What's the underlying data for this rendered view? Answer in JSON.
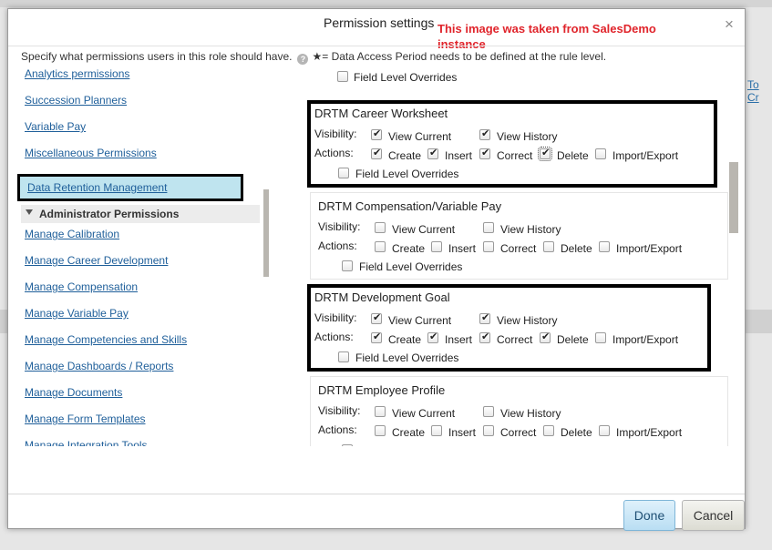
{
  "dialog": {
    "title": "Permission settings",
    "note": "This image was taken from SalesDemo instance",
    "description": "Specify what permissions users in this role should have.",
    "help_glyph": "?",
    "data_access_note": "★= Data Access Period needs to be defined at the rule level.",
    "close": "×",
    "done": "Done",
    "cancel": "Cancel"
  },
  "background": {
    "link_fragment": "To Cr"
  },
  "nav": {
    "items_top": [
      "Analytics permissions",
      "Succession Planners",
      "Variable Pay",
      "Miscellaneous Permissions"
    ],
    "selected": "Data Retention Management",
    "section": "Administrator Permissions",
    "items_bottom": [
      "Manage Calibration",
      "Manage Career Development",
      "Manage Compensation",
      "Manage Variable Pay",
      "Manage Competencies and Skills",
      "Manage Dashboards / Reports",
      "Manage Documents",
      "Manage Form Templates",
      "Manage Integration Tools"
    ]
  },
  "labels": {
    "visibility": "Visibility:",
    "actions": "Actions:",
    "view_current": "View Current",
    "view_history": "View History",
    "create": "Create",
    "insert": "Insert",
    "correct": "Correct",
    "delete": "Delete",
    "import_export": "Import/Export",
    "field_overrides": "Field Level Overrides"
  },
  "cards": [
    {
      "title": "DRTM Career Worksheet",
      "highlighted": true,
      "view_current": true,
      "view_history": true,
      "create": true,
      "insert": true,
      "correct": true,
      "delete": true,
      "import_export": false,
      "field_overrides": false
    },
    {
      "title": "DRTM Compensation/Variable Pay",
      "highlighted": false,
      "view_current": false,
      "view_history": false,
      "create": false,
      "insert": false,
      "correct": false,
      "delete": false,
      "import_export": false,
      "field_overrides": false
    },
    {
      "title": "DRTM Development Goal",
      "highlighted": true,
      "view_current": true,
      "view_history": true,
      "create": true,
      "insert": true,
      "correct": true,
      "delete": true,
      "import_export": false,
      "field_overrides": false
    },
    {
      "title": "DRTM Employee Profile",
      "highlighted": false,
      "view_current": false,
      "view_history": false,
      "create": false,
      "insert": false,
      "correct": false,
      "delete": false,
      "import_export": false,
      "field_overrides": false
    }
  ]
}
